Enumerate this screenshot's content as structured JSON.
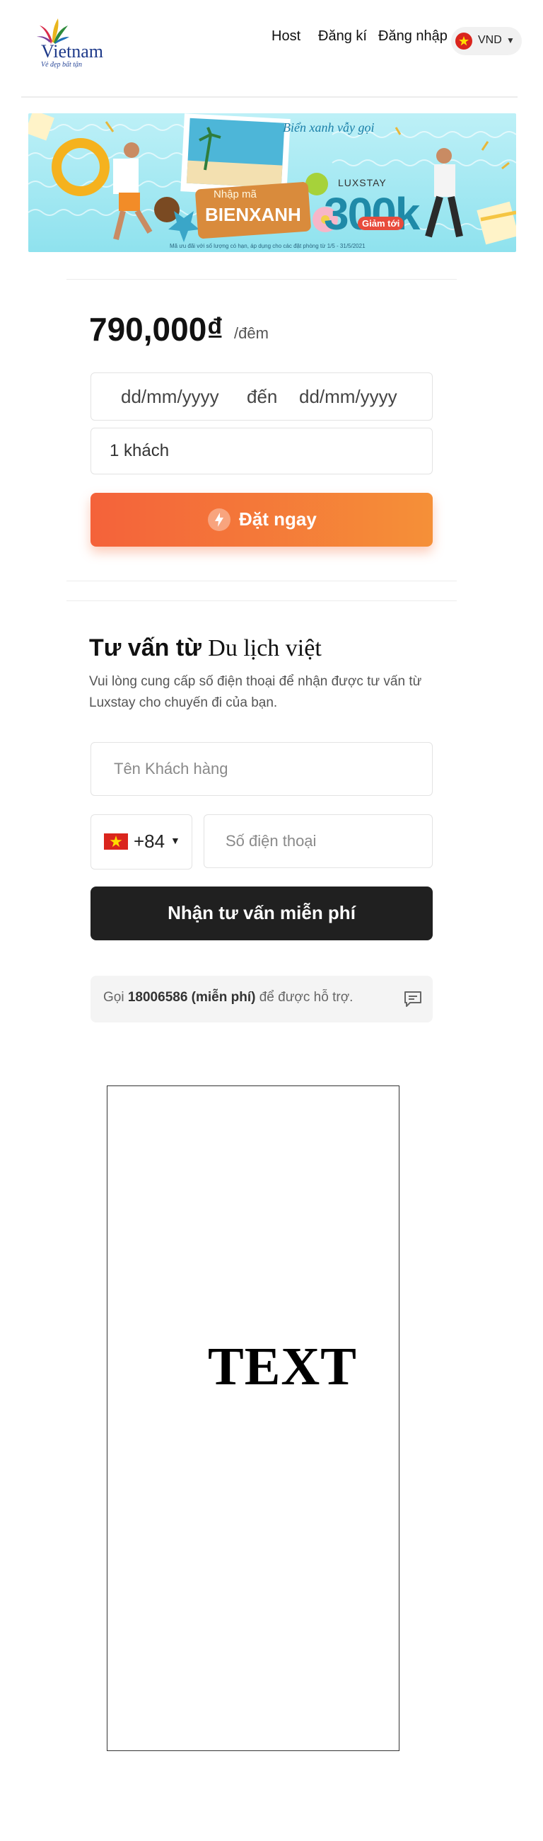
{
  "header": {
    "logo_text": "Vietnam",
    "logo_tagline": "Vẻ đẹp bất tận",
    "nav": {
      "host": "Host",
      "register": "Đăng kí",
      "login": "Đăng nhập"
    },
    "currency": "VND"
  },
  "banner": {
    "script_text": "Biển xanh vẫy gọi",
    "promo_label": "Nhập mã",
    "promo_code": "BIENXANH",
    "brand": "LUXSTAY",
    "discount_label": "Giảm tới",
    "discount_amount": "300k",
    "fine_print": "Mã ưu đãi với số lượng có hạn, áp dụng cho các đặt phòng từ 1/5 - 31/5/2021"
  },
  "booking": {
    "price": "790,000₫",
    "price_unit": "/đêm",
    "check_in_placeholder": "dd/mm/yyyy",
    "date_separator": "đến",
    "check_out_placeholder": "dd/mm/yyyy",
    "guests": "1 khách",
    "book_button": "Đặt ngay"
  },
  "consult": {
    "title_part1": "Tư vấn từ",
    "title_part2": "Du lịch việt",
    "description": "Vui lòng cung cấp số điện thoại để nhận được tư vấn từ Luxstay cho chuyến đi của bạn.",
    "name_placeholder": "Tên Khách hàng",
    "country_code": "+84",
    "phone_placeholder": "Số điện thoại",
    "submit_button": "Nhận tư vấn miễn phí",
    "hotline_prefix": "Gọi",
    "hotline_number": "18006586 (miễn phí)",
    "hotline_suffix": "để được hỗ trợ."
  },
  "frame": {
    "text": "TEXT"
  },
  "colors": {
    "accent_orange": "#f4623a",
    "dark_button": "#202020",
    "vn_red": "#da251d",
    "vn_yellow": "#ffde00"
  }
}
